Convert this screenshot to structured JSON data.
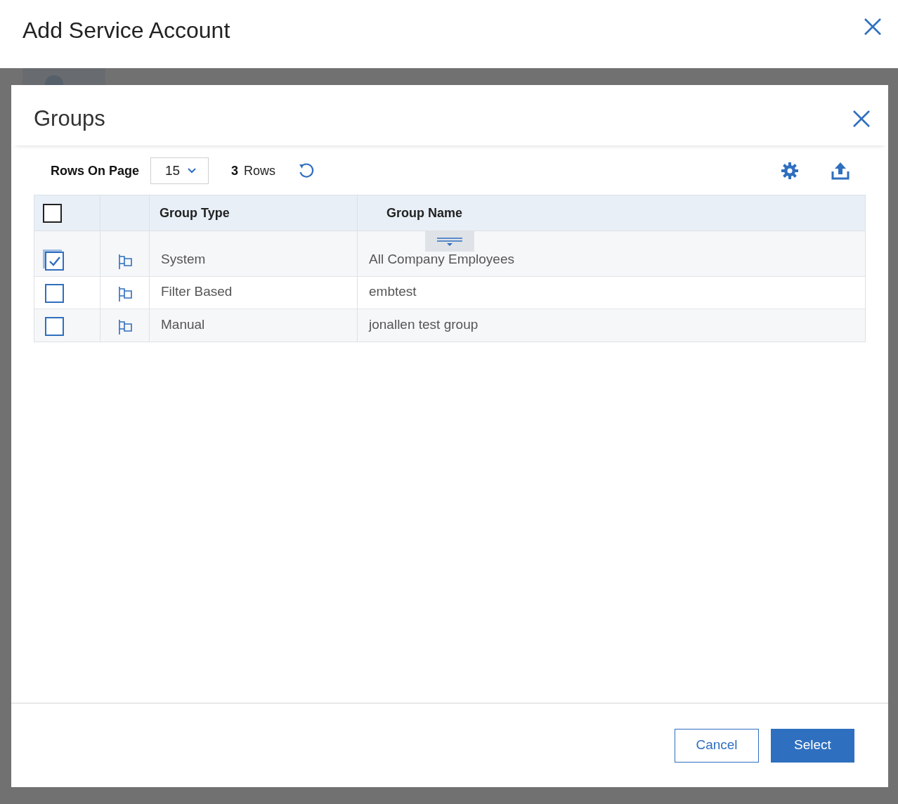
{
  "page": {
    "title": "Add Service Account"
  },
  "dialog": {
    "title": "Groups",
    "toolbar": {
      "rows_label": "Rows On Page",
      "page_size": "15",
      "row_count": "3",
      "row_count_label": "Rows"
    },
    "table": {
      "columns": [
        "Group Type",
        "Group Name"
      ],
      "all_checked": false,
      "rows": [
        {
          "checked": true,
          "group_type": "System",
          "group_name": "All Company Employees"
        },
        {
          "checked": false,
          "group_type": "Filter Based",
          "group_name": "embtest"
        },
        {
          "checked": false,
          "group_type": "Manual",
          "group_name": "jonallen test group"
        }
      ]
    },
    "buttons": [
      {
        "label": "Cancel",
        "kind": "secondary"
      },
      {
        "label": "Select",
        "kind": "primary"
      }
    ]
  }
}
